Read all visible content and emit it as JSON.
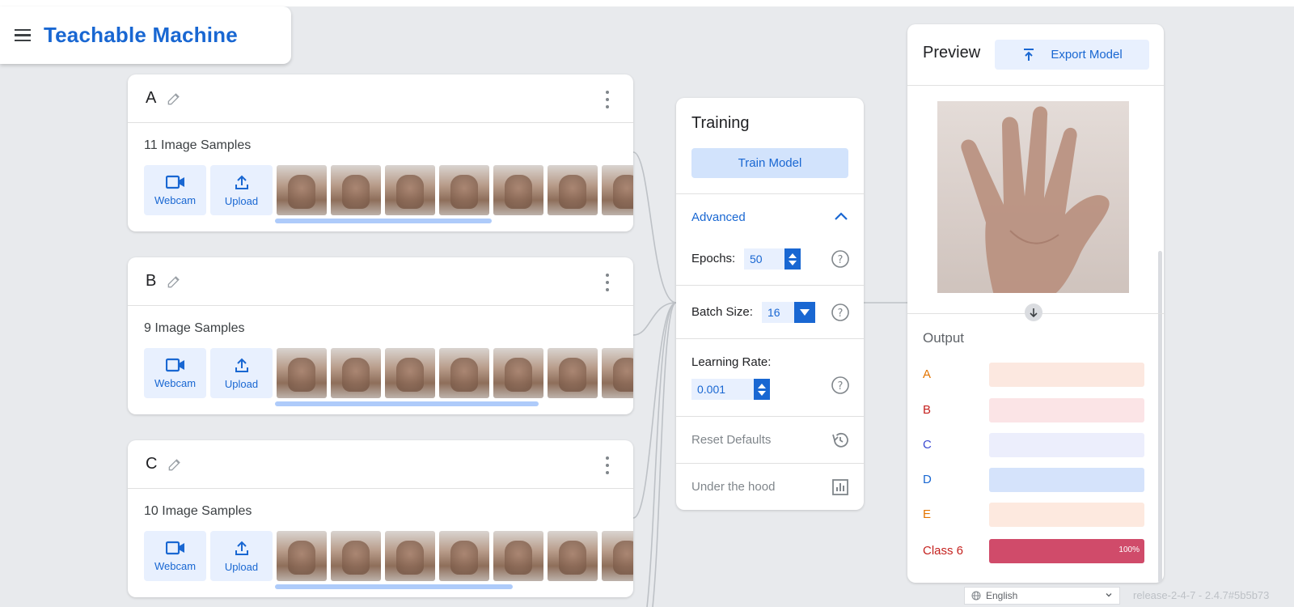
{
  "app": {
    "title": "Teachable Machine",
    "brand_color": "#1967d2"
  },
  "classes": [
    {
      "name": "A",
      "count_label": "11 Image Samples",
      "webcam_label": "Webcam",
      "upload_label": "Upload",
      "samples_scroll_fraction": 0.5
    },
    {
      "name": "B",
      "count_label": "9 Image Samples",
      "webcam_label": "Webcam",
      "upload_label": "Upload",
      "samples_scroll_fraction": 0.61
    },
    {
      "name": "C",
      "count_label": "10 Image Samples",
      "webcam_label": "Webcam",
      "upload_label": "Upload",
      "samples_scroll_fraction": 0.55
    }
  ],
  "training": {
    "title": "Training",
    "train_button": "Train Model",
    "advanced_label": "Advanced",
    "epochs_label": "Epochs:",
    "epochs_value": "50",
    "batch_size_label": "Batch Size:",
    "batch_size_value": "16",
    "learning_rate_label": "Learning Rate:",
    "learning_rate_value": "0.001",
    "reset_defaults": "Reset Defaults",
    "under_the_hood": "Under the hood"
  },
  "preview": {
    "title": "Preview",
    "export_button": "Export Model",
    "output_title": "Output",
    "outputs": [
      {
        "label": "A",
        "color": "#e37400",
        "track": "#fce8e0",
        "fill": "#f6aea9",
        "value": 0,
        "value_label": ""
      },
      {
        "label": "B",
        "color": "#c5221f",
        "track": "#fbe4e6",
        "fill": "#d56878",
        "value": 0,
        "value_label": ""
      },
      {
        "label": "C",
        "color": "#3c4bd1",
        "track": "#eceefc",
        "fill": "#8e98e6",
        "value": 0,
        "value_label": ""
      },
      {
        "label": "D",
        "color": "#1967d2",
        "track": "#d5e3fb",
        "fill": "#1967d2",
        "value": 0,
        "value_label": ""
      },
      {
        "label": "E",
        "color": "#e37400",
        "track": "#fde9df",
        "fill": "#f28b5b",
        "value": 0,
        "value_label": ""
      },
      {
        "label": "Class 6",
        "color": "#c5221f",
        "track": "#f4c7cf",
        "fill": "#d04b6a",
        "value": 1.0,
        "value_label": "100%"
      }
    ]
  },
  "footer": {
    "language": "English",
    "release": "release-2-4-7 - 2.4.7#5b5b73"
  }
}
